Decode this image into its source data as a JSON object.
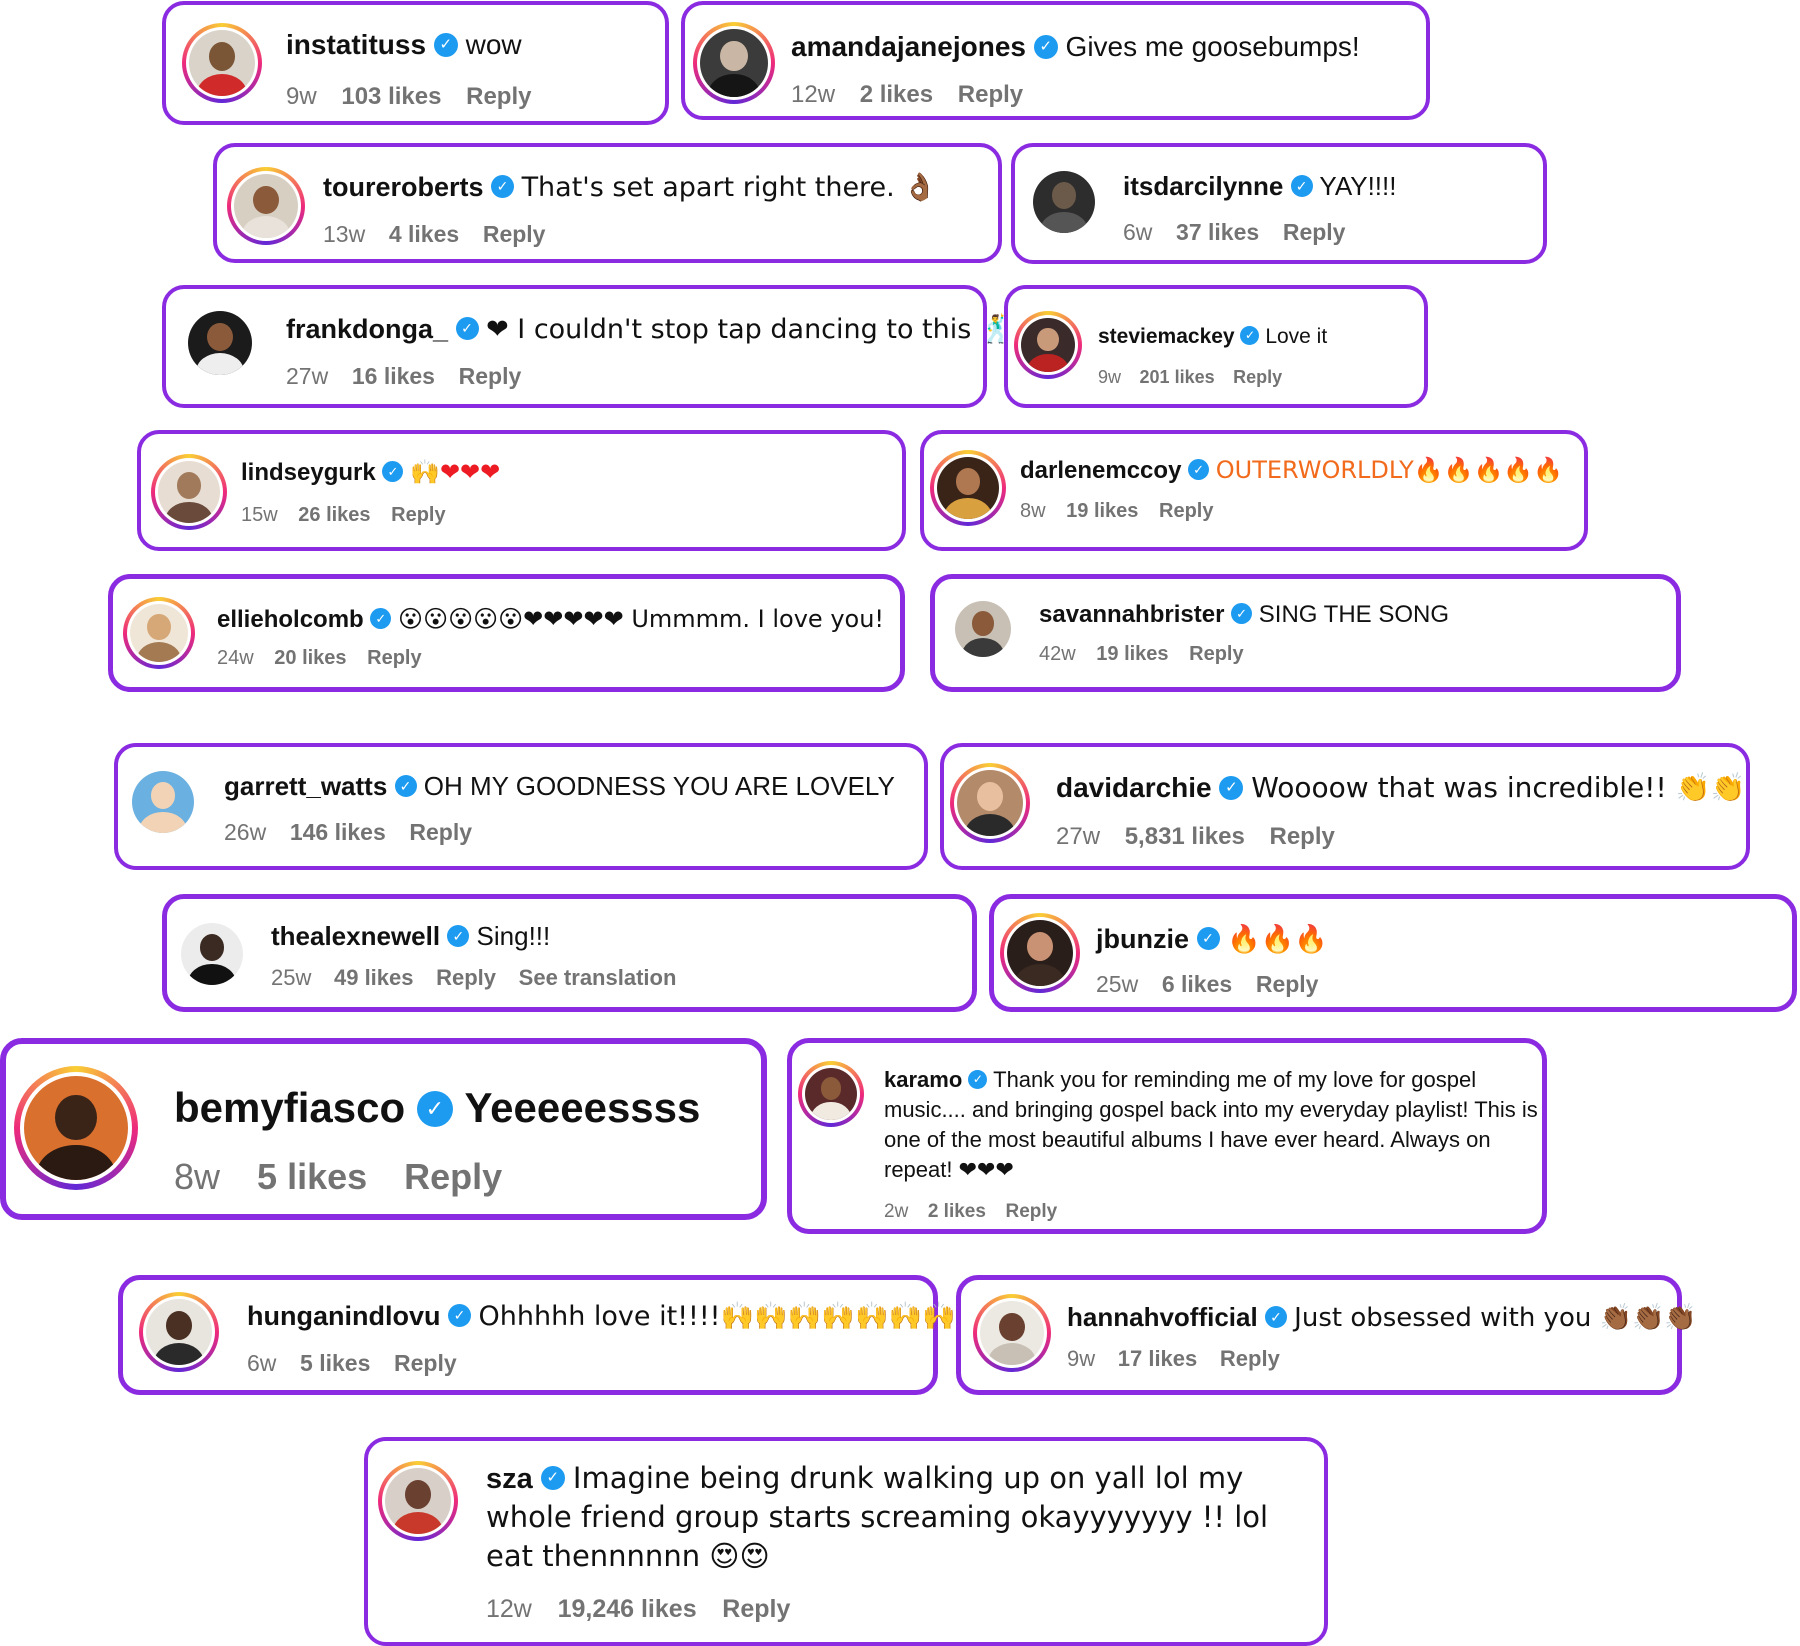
{
  "colors": {
    "card_border": "#8a2be2",
    "verified": "#1d9bf0",
    "meta": "#737373"
  },
  "comments": [
    {
      "username": "instatituss",
      "verified": true,
      "text": "wow",
      "age": "9w",
      "likes": "103 likes",
      "reply": "Reply"
    },
    {
      "username": "amandajanejones",
      "verified": true,
      "text": "Gives me goosebumps!",
      "age": "12w",
      "likes": "2 likes",
      "reply": "Reply"
    },
    {
      "username": "toureroberts",
      "verified": true,
      "text": "That's set apart right there. 👌🏾",
      "age": "13w",
      "likes": "4 likes",
      "reply": "Reply"
    },
    {
      "username": "itsdarcilynne",
      "verified": true,
      "text": "YAY!!!!",
      "age": "6w",
      "likes": "37 likes",
      "reply": "Reply"
    },
    {
      "username": "frankdonga_",
      "verified": true,
      "text": "❤ I couldn't stop tap dancing to this 🕺",
      "age": "27w",
      "likes": "16 likes",
      "reply": "Reply"
    },
    {
      "username": "steviemackey",
      "verified": true,
      "text": "Love it",
      "age": "9w",
      "likes": "201 likes",
      "reply": "Reply"
    },
    {
      "username": "lindseygurk",
      "verified": true,
      "text": "🙌❤❤❤",
      "age": "15w",
      "likes": "26 likes",
      "reply": "Reply"
    },
    {
      "username": "darlenemccoy",
      "verified": true,
      "text": "OUTERWORLDLY🔥🔥🔥🔥🔥",
      "age": "8w",
      "likes": "19 likes",
      "reply": "Reply"
    },
    {
      "username": "ellieholcomb",
      "verified": true,
      "text": "😮😮😮😮😮❤❤❤❤❤ Ummmm. I love you!",
      "age": "24w",
      "likes": "20 likes",
      "reply": "Reply"
    },
    {
      "username": "savannahbrister",
      "verified": true,
      "text": "SING THE SONG",
      "age": "42w",
      "likes": "19 likes",
      "reply": "Reply"
    },
    {
      "username": "garrett_watts",
      "verified": true,
      "text": "OH MY GOODNESS YOU ARE LOVELY",
      "age": "26w",
      "likes": "146 likes",
      "reply": "Reply"
    },
    {
      "username": "davidarchie",
      "verified": true,
      "text": "Woooow that was incredible!! 👏👏",
      "age": "27w",
      "likes": "5,831 likes",
      "reply": "Reply"
    },
    {
      "username": "thealexnewell",
      "verified": true,
      "text": "Sing!!!",
      "age": "25w",
      "likes": "49 likes",
      "reply": "Reply",
      "extra": "See translation"
    },
    {
      "username": "jbunzie",
      "verified": true,
      "text": "🔥🔥🔥",
      "age": "25w",
      "likes": "6 likes",
      "reply": "Reply"
    },
    {
      "username": "bemyfiasco",
      "verified": true,
      "text": "Yeeeeessss",
      "age": "8w",
      "likes": "5 likes",
      "reply": "Reply"
    },
    {
      "username": "karamo",
      "verified": true,
      "text": "Thank you for reminding me of my love for gospel music.... and bringing gospel back into my everyday playlist! This is one of the most beautiful albums I have ever heard. Always on repeat! ❤❤❤",
      "age": "2w",
      "likes": "2 likes",
      "reply": "Reply"
    },
    {
      "username": "hunganindlovu",
      "verified": true,
      "text": "Ohhhhh love it!!!!🙌🙌🙌🙌🙌🙌🙌",
      "age": "6w",
      "likes": "5 likes",
      "reply": "Reply"
    },
    {
      "username": "hannahvofficial",
      "verified": true,
      "text": "Just obsessed with you 👏🏾👏🏾👏🏾",
      "age": "9w",
      "likes": "17 likes",
      "reply": "Reply"
    },
    {
      "username": "sza",
      "verified": true,
      "text": "Imagine being drunk walking up on yall lol my whole friend group starts screaming okayyyyyyy !! lol eat thennnnnn 😍😍",
      "age": "12w",
      "likes": "19,246 likes",
      "reply": "Reply"
    }
  ]
}
